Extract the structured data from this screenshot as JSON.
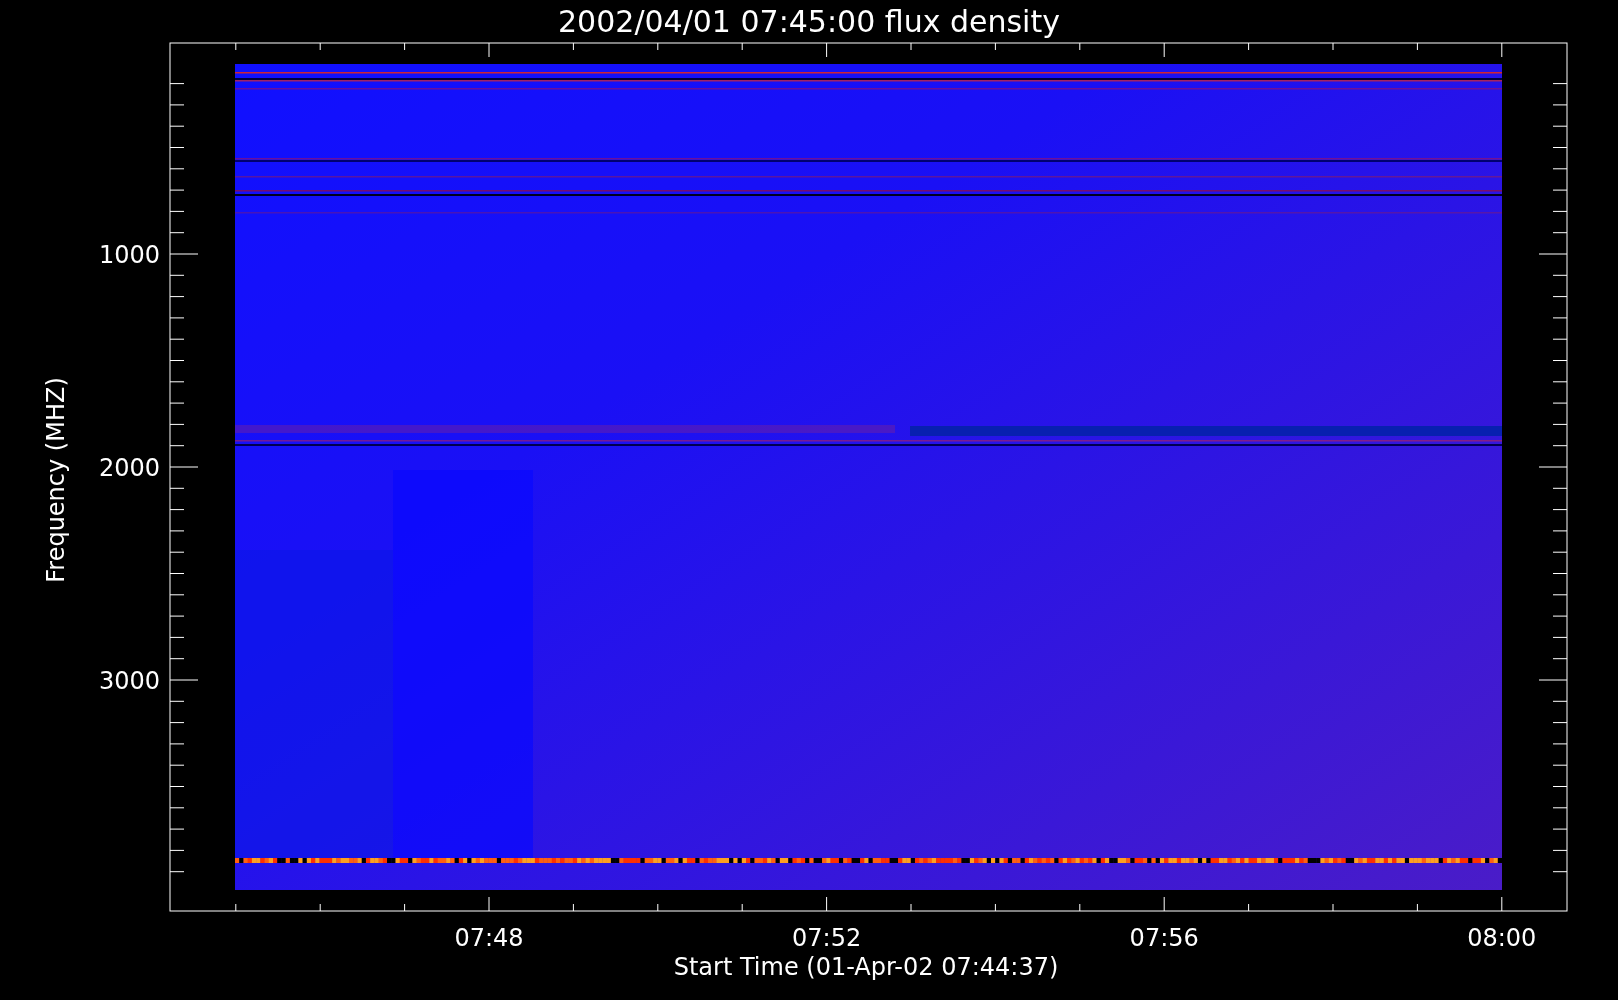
{
  "plot": {
    "title": "2002/04/01 07:45:00 flux density",
    "xlabel": "Start Time (01-Apr-02 07:44:37)",
    "ylabel": "Frequency (MHZ)",
    "xtick_labels": [
      "07:48",
      "07:52",
      "07:56",
      "08:00"
    ],
    "ytick_labels": [
      "1000",
      "2000",
      "3000"
    ]
  }
}
